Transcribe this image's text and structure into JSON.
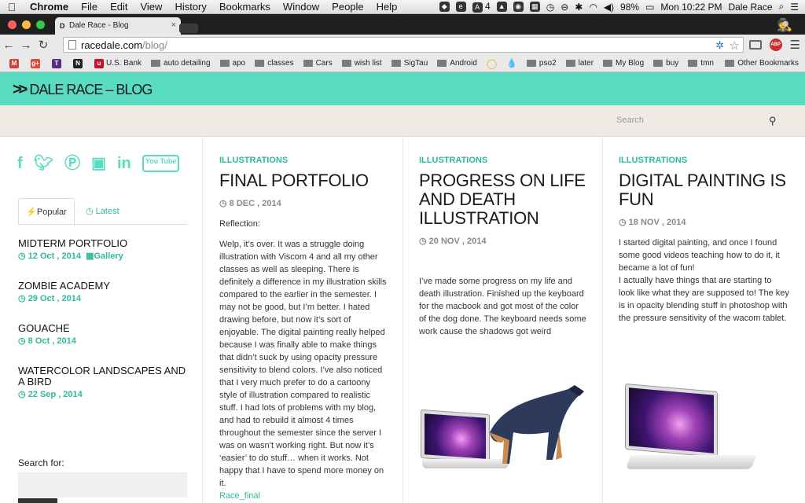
{
  "menubar": {
    "apple": "",
    "app": "Chrome",
    "items": [
      "File",
      "Edit",
      "View",
      "History",
      "Bookmarks",
      "Window",
      "People",
      "Help"
    ],
    "status_badge": "4",
    "battery": "98%",
    "clock": "Mon 10:22 PM",
    "user": "Dale Race"
  },
  "browser": {
    "tab_title": "Dale Race - Blog",
    "tab_favicon": "D",
    "url_host": "racedale.com",
    "url_path": "/blog/",
    "abp": "ABP",
    "bookmarks": [
      {
        "label": "",
        "kind": "gmail"
      },
      {
        "label": "",
        "kind": "gplus"
      },
      {
        "label": "",
        "kind": "t"
      },
      {
        "label": "",
        "kind": "nf"
      },
      {
        "label": "U.S. Bank",
        "kind": "site"
      },
      {
        "label": "auto detailing",
        "kind": "folder"
      },
      {
        "label": "apo",
        "kind": "folder"
      },
      {
        "label": "classes",
        "kind": "folder"
      },
      {
        "label": "Cars",
        "kind": "folder"
      },
      {
        "label": "wish list",
        "kind": "folder"
      },
      {
        "label": "SigTau",
        "kind": "folder"
      },
      {
        "label": "Android",
        "kind": "folder"
      },
      {
        "label": "",
        "kind": "o"
      },
      {
        "label": "",
        "kind": "drop"
      },
      {
        "label": "pso2",
        "kind": "folder"
      },
      {
        "label": "later",
        "kind": "folder"
      },
      {
        "label": "My Blog",
        "kind": "folder"
      },
      {
        "label": "buy",
        "kind": "folder"
      },
      {
        "label": "tmn",
        "kind": "folder"
      }
    ],
    "other_bookmarks": "Other Bookmarks"
  },
  "site": {
    "logo": "DALE RACE – BLOG",
    "search_placeholder": "Search",
    "accent": "#58dbc0"
  },
  "sidebar": {
    "social": [
      "facebook-icon",
      "twitter-icon",
      "pinterest-icon",
      "instagram-icon",
      "linkedin-icon",
      "youtube-icon"
    ],
    "youtube_text": "You Tube",
    "tab_popular": "Popular",
    "tab_latest": "Latest",
    "popular": [
      {
        "title": "MIDTERM PORTFOLIO",
        "date": "12 Oct , 2014",
        "tag": "Gallery"
      },
      {
        "title": "ZOMBIE ACADEMY",
        "date": "29 Oct , 2014",
        "tag": ""
      },
      {
        "title": "GOUACHE",
        "date": "8 Oct , 2014",
        "tag": ""
      },
      {
        "title": "WATERCOLOR LANDSCAPES AND A BIRD",
        "date": "22 Sep , 2014",
        "tag": ""
      }
    ],
    "search_label": "Search for:"
  },
  "posts": [
    {
      "category": "ILLUSTRATIONS",
      "title": "FINAL PORTFOLIO",
      "date": "8 DEC , 2014",
      "intro": "Reflection:",
      "body": "Welp, it’s over.  It was a struggle doing illustration with Viscom 4 and all my other classes as well as sleeping.  There is definitely a difference in my illustration skills compared to the earlier in the semester.  I may not be good, but I’m better.  I hated drawing before, but now it’s sort of enjoyable.  The digital painting really helped because I was finally able to make things that didn’t suck by using opacity pressure sensitivity to blend colors.  I’ve also noticed that I very much prefer to do a cartoony style of illustration compared to realistic stuff.  I had lots of problems with my blog, and had to rebuild it almost 4 times throughout the semester since the server I was on wasn’t working right.  But now it’s ‘easier’ to do stuff… when it works.  Not happy that I have to spend more money on it.",
      "readmore": "Race_final"
    },
    {
      "category": "ILLUSTRATIONS",
      "title": "PROGRESS ON LIFE AND DEATH ILLUSTRATION",
      "date": "20 NOV , 2014",
      "body": "I’ve made some progress on my life and death illustration.  Finished up the keyboard for the macbook and got most of the color of the dog done.  The keyboard needs some work cause the shadows got weird"
    },
    {
      "category": "ILLUSTRATIONS",
      "title": "DIGITAL PAINTING IS FUN",
      "date": "18 NOV , 2014",
      "body1": "I started digital painting, and once I found some good videos teaching how to do it, it became a lot of fun!",
      "body2": "I actually have things that are starting to look like what they are supposed to!  The key is in opacity blending stuff in photoshop with the pressure sensitivity of the wacom tablet."
    }
  ]
}
